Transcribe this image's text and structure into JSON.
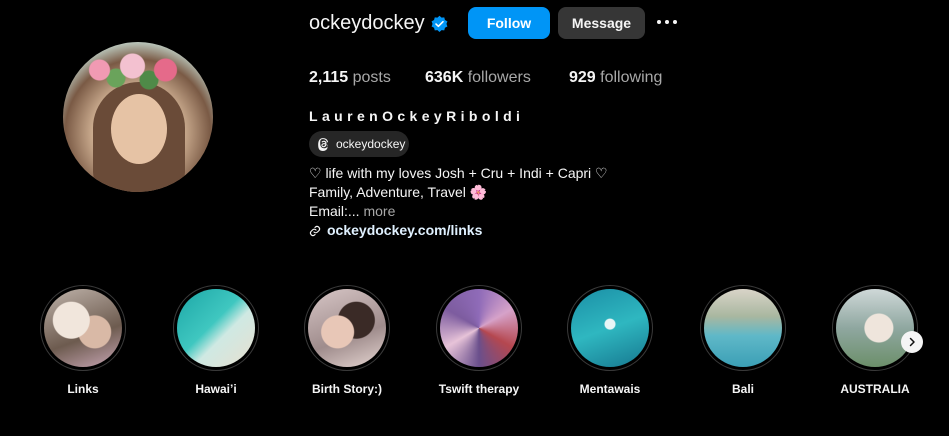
{
  "profile": {
    "username": "ockeydockey",
    "verified_icon": "verified-badge-icon",
    "follow_label": "Follow",
    "message_label": "Message",
    "more_icon": "more-options-icon",
    "full_name": "LaurenOckeyRiboldi",
    "threads_handle": "ockeydockey",
    "stats": {
      "posts_count": "2,115",
      "posts_label": "posts",
      "followers_count": "636K",
      "followers_label": "followers",
      "following_count": "929",
      "following_label": "following"
    },
    "bio": {
      "line1": "♡ life with my loves Josh + Cru + Indi + Capri ♡",
      "line2": "Family, Adventure, Travel 🌸",
      "line3_prefix": "Email:...",
      "line3_more": "more",
      "link_text": "ockeydockey.com/links"
    }
  },
  "highlights": [
    {
      "label": "Links"
    },
    {
      "label": "Hawai’i"
    },
    {
      "label": "Birth Story:)"
    },
    {
      "label": "Tswift therapy"
    },
    {
      "label": "Mentawais"
    },
    {
      "label": "Bali"
    },
    {
      "label": "AUSTRALIA"
    }
  ],
  "colors": {
    "background": "#000000",
    "follow_button": "#0095f6",
    "message_button": "#363636",
    "verified_blue": "#0095f6"
  }
}
